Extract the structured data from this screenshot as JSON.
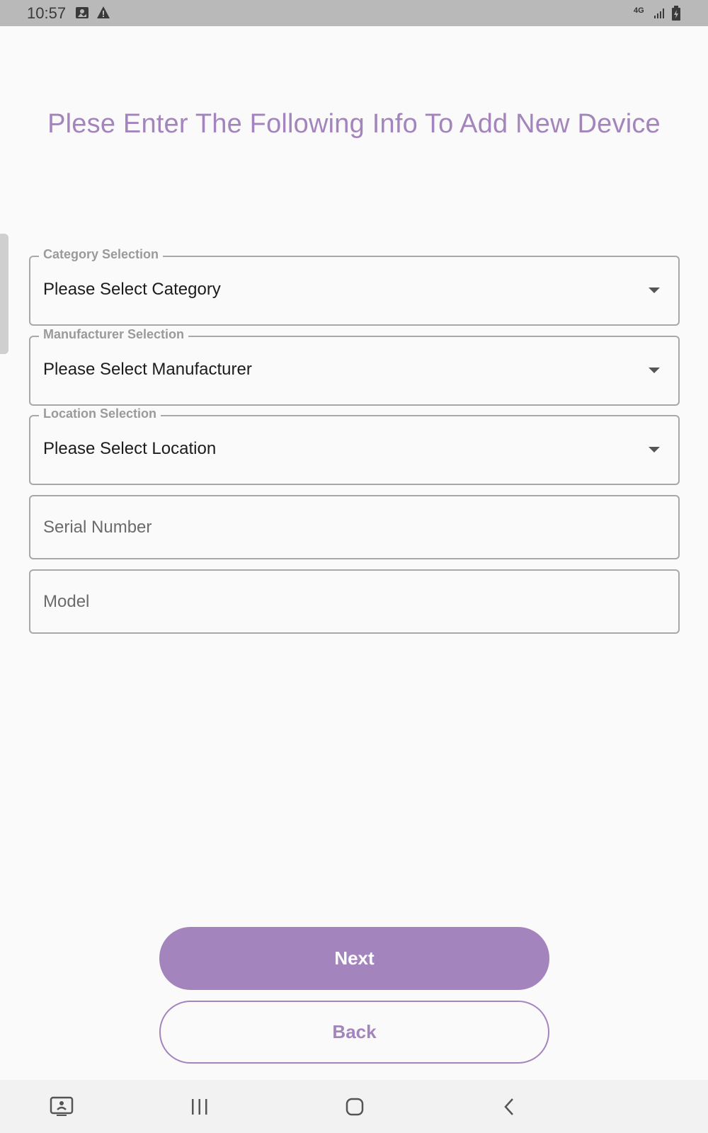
{
  "status_bar": {
    "time": "10:57",
    "left_icons": [
      "image-notification-icon",
      "warning-icon"
    ],
    "right_icons": [
      "4g-lte-icon",
      "signal-icon",
      "battery-charging-icon"
    ],
    "network_label": "4G"
  },
  "title": "Plese Enter The Following Info To Add New Device",
  "fields": {
    "category": {
      "label": "Category Selection",
      "value": "Please Select Category"
    },
    "manufacturer": {
      "label": "Manufacturer Selection",
      "value": "Please Select Manufacturer"
    },
    "location": {
      "label": "Location Selection",
      "value": "Please Select Location"
    },
    "serial": {
      "placeholder": "Serial Number"
    },
    "model": {
      "placeholder": "Model"
    }
  },
  "buttons": {
    "next": "Next",
    "back": "Back"
  },
  "nav_bar": {
    "icons": [
      "screen-share-icon",
      "recent-apps-icon",
      "home-icon",
      "back-icon"
    ]
  },
  "colors": {
    "accent": "#a384bd",
    "status_bar": "#b9b9b9",
    "background": "#fafafa"
  }
}
